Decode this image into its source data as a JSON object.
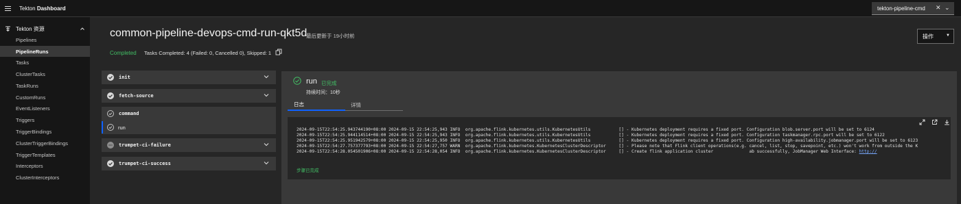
{
  "header": {
    "brand_prefix": "Tekton",
    "brand_bold": "Dashboard",
    "namespace_value": "tekton-pipeline-cmd",
    "clear_symbol": "✕",
    "chevron_symbol": "⌄"
  },
  "sidebar": {
    "section_label": "Tekton 资源",
    "items": [
      {
        "label": "Pipelines"
      },
      {
        "label": "PipelineRuns"
      },
      {
        "label": "Tasks"
      },
      {
        "label": "ClusterTasks"
      },
      {
        "label": "TaskRuns"
      },
      {
        "label": "CustomRuns"
      },
      {
        "label": "EventListeners"
      },
      {
        "label": "Triggers"
      },
      {
        "label": "TriggerBindings"
      },
      {
        "label": "ClusterTriggerBindings"
      },
      {
        "label": "TriggerTemplates"
      },
      {
        "label": "Interceptors"
      },
      {
        "label": "ClusterInterceptors"
      }
    ]
  },
  "run": {
    "title": "common-pipeline-devops-cmd-run-qkt5d",
    "updated": "最后更新于 19小时前",
    "status": "Completed",
    "tasks_summary": "Tasks Completed: 4 (Failed: 0, Cancelled 0), Skipped: 1",
    "actions_label": "操作"
  },
  "tasks": [
    {
      "name": "init",
      "status": "succeeded"
    },
    {
      "name": "fetch-source",
      "status": "succeeded"
    },
    {
      "name": "command",
      "status": "succeeded",
      "steps": [
        {
          "name": "run"
        }
      ]
    },
    {
      "name": "trumpet-ci-failure",
      "status": "skipped"
    },
    {
      "name": "trumpet-ci-success",
      "status": "succeeded"
    }
  ],
  "step": {
    "name": "run",
    "status": "已完成",
    "duration": "持续时间：10秒",
    "tabs": [
      "日志",
      "详情"
    ],
    "log_lines": [
      "2024-09-15T22:54:25.943744190+08:00 2024-09-15 22:54:25,943 INFO  org.apache.flink.kubernetes.utils.KubernetesUtils           [] - Kubernetes deployment requires a fixed port. Configuration blob.server.port will be set to 6124",
      "2024-09-15T22:54:25.944114514+08:00 2024-09-15 22:54:25,943 INFO  org.apache.flink.kubernetes.utils.KubernetesUtils           [] - Kubernetes deployment requires a fixed port. Configuration taskmanager.rpc.port will be set to 6122",
      "2024-09-15T22:54:25.951942579+08:00 2024-09-15 22:54:25,950 INFO  org.apache.flink.kubernetes.utils.KubernetesUtils           [] - Kubernetes deployment requires a fixed port. Configuration high-availability.jobmanager.port will be set to 6123",
      "2024-09-15T22:54:27.757377793+08:00 2024-09-15 22:54:27,757 WARN  org.apache.flink.kubernetes.KubernetesClusterDescriptor     [] - Please note that Flink client operations(e.g. cancel, list, stop, savepoint, etc.) won't work from outside the K",
      "2024-09-15T22:54:28.054501906+08:00 2024-09-15 22:54:28,054 INFO  org.apache.flink.kubernetes.KubernetesClusterDescriptor     [] - Create flink application cluster              ab successfully, JobManager Web Interface: "
    ],
    "log_link": "http://",
    "log_done": "步骤已完成"
  }
}
